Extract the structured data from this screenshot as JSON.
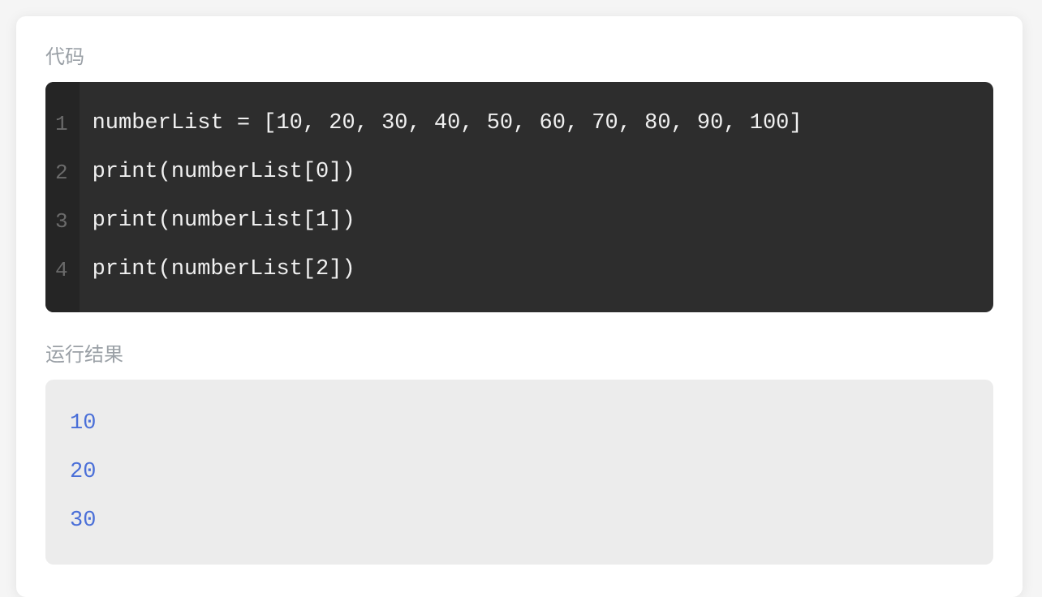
{
  "labels": {
    "code": "代码",
    "output": "运行结果"
  },
  "code": {
    "lineNumbers": [
      "1",
      "2",
      "3",
      "4"
    ],
    "lines": [
      "numberList = [10, 20, 30, 40, 50, 60, 70, 80, 90, 100]",
      "print(numberList[0])",
      "print(numberList[1])",
      "print(numberList[2])"
    ]
  },
  "output": {
    "lines": [
      "10",
      "20",
      "30"
    ]
  }
}
